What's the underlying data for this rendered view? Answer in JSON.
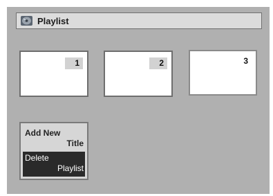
{
  "title_bar": {
    "icon": "disc-icon",
    "title": "Playlist"
  },
  "playlist": {
    "items": [
      {
        "number": "1"
      },
      {
        "number": "2"
      },
      {
        "number": "3"
      }
    ]
  },
  "menu": {
    "add_new_title": {
      "line1": "Add New",
      "line2": "Title"
    },
    "delete_playlist": {
      "line1": "Delete",
      "line2": "Playlist"
    },
    "selected": "delete_playlist"
  },
  "colors": {
    "background": "#b0b0b0",
    "title_bar": "#dcdcdc",
    "highlight": "#2a2a2a"
  }
}
